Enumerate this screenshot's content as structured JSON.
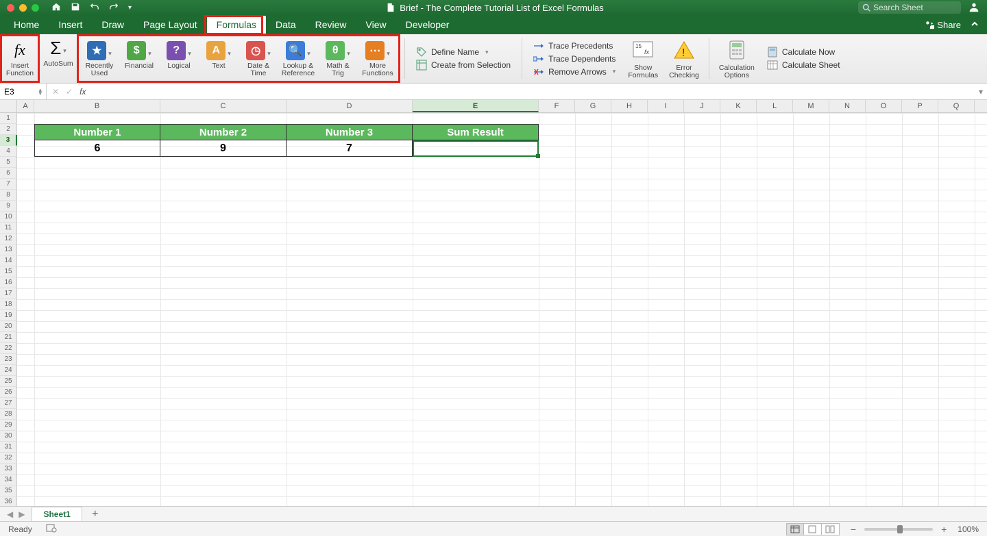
{
  "title": "Brief - The Complete Tutorial List of Excel Formulas",
  "search_placeholder": "Search Sheet",
  "tabs": [
    "Home",
    "Insert",
    "Draw",
    "Page Layout",
    "Formulas",
    "Data",
    "Review",
    "View",
    "Developer"
  ],
  "active_tab": "Formulas",
  "share_label": "Share",
  "ribbon": {
    "insert_function": "Insert\nFunction",
    "autosum": "AutoSum",
    "library": [
      {
        "label": "Recently\nUsed",
        "color": "#2f6db5",
        "glyph": "★"
      },
      {
        "label": "Financial",
        "color": "#4fa845",
        "glyph": "$"
      },
      {
        "label": "Logical",
        "color": "#7b4fb0",
        "glyph": "?"
      },
      {
        "label": "Text",
        "color": "#e8a33d",
        "glyph": "A"
      },
      {
        "label": "Date &\nTime",
        "color": "#d9534f",
        "glyph": "◷"
      },
      {
        "label": "Lookup &\nReference",
        "color": "#3b7dd8",
        "glyph": "🔍"
      },
      {
        "label": "Math &\nTrig",
        "color": "#5cb85c",
        "glyph": "θ"
      },
      {
        "label": "More\nFunctions",
        "color": "#e67e22",
        "glyph": "⋯"
      }
    ],
    "define_name": "Define Name",
    "create_selection": "Create from Selection",
    "trace_precedents": "Trace Precedents",
    "trace_dependents": "Trace Dependents",
    "remove_arrows": "Remove Arrows",
    "show_formulas": "Show\nFormulas",
    "error_checking": "Error\nChecking",
    "calculation_options": "Calculation\nOptions",
    "calculate_now": "Calculate Now",
    "calculate_sheet": "Calculate Sheet"
  },
  "name_box": "E3",
  "columns_wide": [
    "B",
    "C",
    "D",
    "E"
  ],
  "columns_reg": [
    "F",
    "G",
    "H",
    "I",
    "J",
    "K",
    "L",
    "M",
    "N",
    "O",
    "P",
    "Q"
  ],
  "row_count": 37,
  "table": {
    "headers": [
      "Number 1",
      "Number 2",
      "Number 3",
      "Sum Result"
    ],
    "row": [
      "6",
      "9",
      "7",
      ""
    ]
  },
  "sheet_name": "Sheet1",
  "status": "Ready",
  "zoom": "100%"
}
